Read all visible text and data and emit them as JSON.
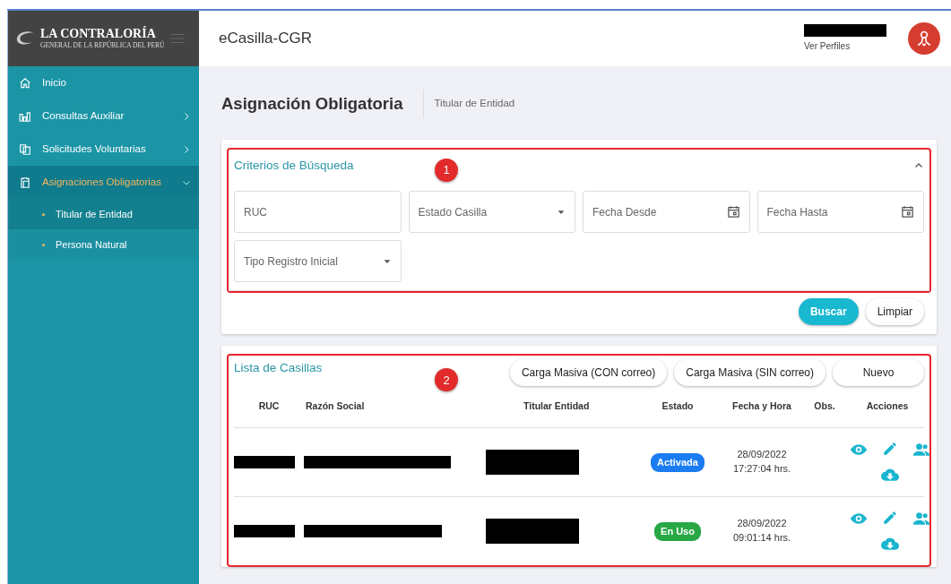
{
  "logo": {
    "title": "LA CONTRALORÍA",
    "subtitle": "GENERAL DE LA REPÚBLICA DEL PERÚ"
  },
  "header": {
    "app_title": "eCasilla-CGR",
    "profile_link": "Ver Perfiles"
  },
  "sidebar": {
    "items": [
      {
        "label": "Inicio",
        "has_submenu": false,
        "expanded": false,
        "selected": false
      },
      {
        "label": "Consultas Auxiliar",
        "has_submenu": true,
        "expanded": false,
        "selected": false
      },
      {
        "label": "Solicitudes Voluntarias",
        "has_submenu": true,
        "expanded": false,
        "selected": false
      },
      {
        "label": "Asignaciones Obligatorias",
        "has_submenu": true,
        "expanded": true,
        "selected": true,
        "children": [
          {
            "label": "Titular de Entidad",
            "selected": true
          },
          {
            "label": "Persona Natural",
            "selected": false
          }
        ]
      }
    ]
  },
  "page": {
    "title": "Asignación Obligatoria",
    "breadcrumb": "Titular de Entidad"
  },
  "search_panel": {
    "title": "Criterios de Búsqueda",
    "expanded": true,
    "annotation": "1",
    "fields": [
      {
        "kind": "text",
        "placeholder": "RUC"
      },
      {
        "kind": "select",
        "placeholder": "Estado Casilla"
      },
      {
        "kind": "date",
        "placeholder": "Fecha Desde"
      },
      {
        "kind": "date",
        "placeholder": "Fecha Hasta"
      },
      {
        "kind": "select",
        "placeholder": "Tipo Registro Inicial"
      }
    ],
    "buttons": [
      {
        "label": "Buscar",
        "primary": true
      },
      {
        "label": "Limpiar",
        "primary": false
      }
    ]
  },
  "list_panel": {
    "title": "Lista de Casillas",
    "annotation": "2",
    "buttons": [
      "Carga Masiva (CON correo)",
      "Carga Masiva (SIN correo)",
      "Nuevo"
    ],
    "table": {
      "columns": [
        "RUC",
        "Razón Social",
        "Titular Entidad",
        "Estado",
        "Fecha y Hora",
        "Obs.",
        "Acciones"
      ],
      "rows": [
        {
          "status": "Activada",
          "color": "#1a7cf0",
          "date": "28/09/2022",
          "time": "17:27:04 hrs."
        },
        {
          "status": "En Uso",
          "color": "#28a745",
          "date": "28/09/2022",
          "time": "09:01:14 hrs."
        }
      ]
    }
  }
}
